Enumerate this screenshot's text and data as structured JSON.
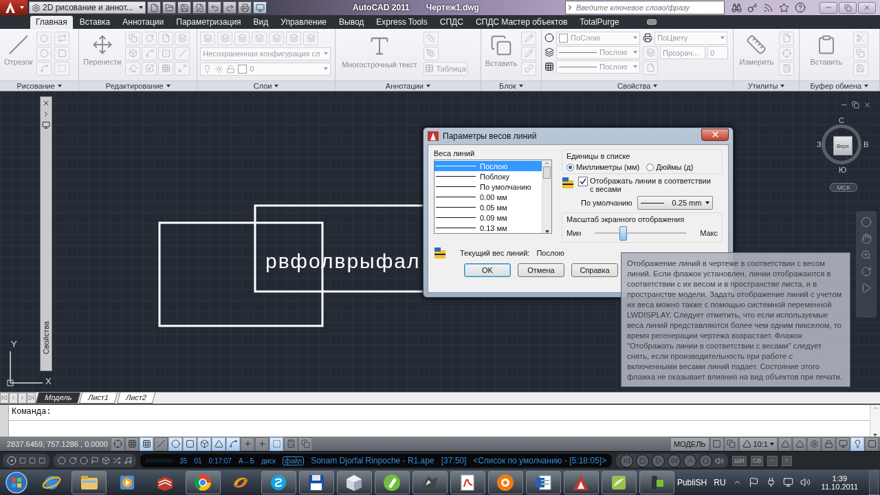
{
  "title_bar": {
    "workspace": "2D рисование и аннот...",
    "app_title": "AutoCAD 2011",
    "file_title": "Чертеж1.dwg",
    "search": {
      "placeholder": "Введите ключевое слово/фразу"
    }
  },
  "ribbon": {
    "tabs": [
      {
        "label": "Главная",
        "selected": true
      },
      {
        "label": "Вставка",
        "selected": false
      },
      {
        "label": "Аннотации",
        "selected": false
      },
      {
        "label": "Параметризация",
        "selected": false
      },
      {
        "label": "Вид",
        "selected": false
      },
      {
        "label": "Управление",
        "selected": false
      },
      {
        "label": "Вывод",
        "selected": false
      },
      {
        "label": "Express Tools",
        "selected": false
      },
      {
        "label": "СПДС",
        "selected": false
      },
      {
        "label": "СПДС Мастер объектов",
        "selected": false
      },
      {
        "label": "TotalPurge",
        "selected": false
      }
    ],
    "panels": [
      {
        "kind": "draw",
        "title": "Рисование",
        "big_tool": "Отрезок"
      },
      {
        "kind": "modify",
        "title": "Редактирование",
        "big_tool": "Перенести"
      },
      {
        "kind": "layers",
        "title": "Слои",
        "layer_state": "Несохраненная конфигурация сл",
        "layer": "0"
      },
      {
        "kind": "annotation",
        "title": "Аннотации",
        "big_tool": "Многострочный текст",
        "table_tool": "Таблица"
      },
      {
        "kind": "block",
        "title": "Блок",
        "big_tool": "Вставить"
      },
      {
        "kind": "properties",
        "title": "Свойства",
        "color_setting": "ПоСлою",
        "linetype": "Послою",
        "lineweight": "Послою",
        "plot_style": "ПоЦвету",
        "transparency": "Прозрач...",
        "transparency_value": "0"
      },
      {
        "kind": "utilities",
        "title": "Утилиты",
        "big_tool": "Измерить"
      },
      {
        "kind": "clipboard",
        "title": "Буфер обмена",
        "big_tool": "Вставить"
      }
    ]
  },
  "palette": {
    "title": "Свойства"
  },
  "canvas": {
    "text": "рвфолврыфал",
    "ucs": {
      "y": "Y",
      "x": "X"
    },
    "viewcube": {
      "north": "С",
      "west": "З",
      "east": "В",
      "south": "Ю",
      "face": "Верх",
      "ucs": "МСК"
    }
  },
  "dialog": {
    "title": "Параметры весов линий",
    "lineweights": {
      "label": "Веса линий",
      "items": [
        {
          "label": "Послою",
          "selected": true
        },
        {
          "label": "Поблоку",
          "selected": false
        },
        {
          "label": "По умолчанию",
          "selected": false
        },
        {
          "label": "0.00 мм",
          "selected": false
        },
        {
          "label": "0.05 мм",
          "selected": false
        },
        {
          "label": "0.09 мм",
          "selected": false
        },
        {
          "label": "0.13 мм",
          "selected": false
        }
      ]
    },
    "units": {
      "label": "Единицы в списке",
      "options": [
        {
          "label": "Миллиметры (мм)",
          "selected": true
        },
        {
          "label": "Дюймы (д)",
          "selected": false
        }
      ]
    },
    "display": {
      "label": "Отображать линии в соответствии с весами",
      "checked": true
    },
    "default": {
      "label": "По умолчанию",
      "value": "0.25 mm"
    },
    "scale": {
      "label": "Масштаб экранного отображения",
      "min": "Мин",
      "max": "Макс",
      "level": 0.3
    },
    "current": {
      "label": "Текущий вес линий:",
      "value": "Послою"
    },
    "buttons": [
      {
        "label": "OK",
        "kind": "default"
      },
      {
        "label": "Отмена",
        "kind": "normal"
      },
      {
        "label": "Справка",
        "kind": "normal"
      }
    ]
  },
  "tooltip": {
    "text": "Отображение линий в чертеже в соответствии с весом линий. Если флажок установлен, линии отображаются в соответствии с их весом и в пространстве листа, и в пространстве модели. Задать отображение линий с учетом их веса можно также с помощью системной переменной LWDISPLAY. Следует отметить, что если используемые веса линий представляются более чем одним пикселом, то время регенерации чертежа возрастает. Флажок \"Отображать линии в соответствии с весами\" следует снять, если производительность при работе с включенными весами линий падает. Состояние этого флажка не оказывает влияния на вид объектов при печати."
  },
  "layout_tabs": [
    {
      "label": "Модель",
      "selected": true
    },
    {
      "label": "Лист1",
      "selected": false
    },
    {
      "label": "Лист2",
      "selected": false
    }
  ],
  "command_line": {
    "prompt": "Команда:"
  },
  "status_bar": {
    "coordinates": "2837.6459, 757.1286 , 0.0000",
    "toggles": [
      {
        "on": false
      },
      {
        "on": false
      },
      {
        "on": true
      },
      {
        "on": false
      },
      {
        "on": true
      },
      {
        "on": true
      },
      {
        "on": true
      },
      {
        "on": true
      },
      {
        "on": true
      },
      {
        "on": false
      },
      {
        "on": false
      },
      {
        "on": true
      },
      {
        "on": false
      },
      {
        "on": false
      }
    ],
    "space": "МОДЕЛЬ",
    "scale": "10:1"
  },
  "media_bar": {
    "track_number": "35",
    "disc": "01",
    "time": "0:17:07",
    "ab": "А↔Б",
    "source": "диск",
    "file_badge": "файл",
    "track": "Sonam Djorfal Rinpoche - R1.ape",
    "duration": "[37:50]",
    "playlist": "<Список по умолчанию - [5:18:05]>",
    "buttons": [
      "ШИ",
      "СВ"
    ]
  },
  "taskbar": {
    "toolbar": "PubliSH",
    "language": "RU",
    "time": "1:39",
    "date": "11.10.2011"
  }
}
